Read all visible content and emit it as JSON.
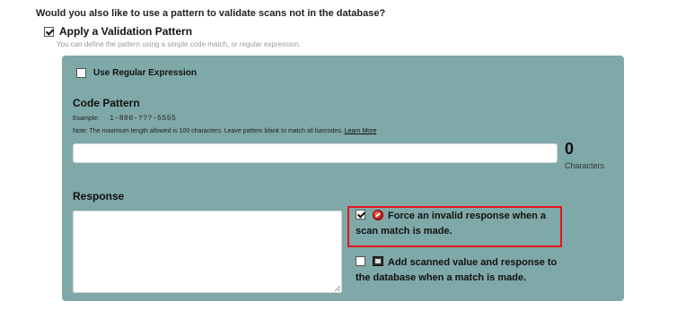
{
  "header": {
    "question": "Would you also like to use a pattern to validate scans not in the database?"
  },
  "validation": {
    "checked": true,
    "label": "Apply a Validation Pattern",
    "description": "You can define the pattern using a simple code match, or regular expression."
  },
  "panel": {
    "bg_color": "#7fa8a8",
    "regex": {
      "checked": false,
      "label": "Use Regular Expression"
    },
    "code_pattern": {
      "title": "Code Pattern",
      "example_label": "Example:",
      "example_value": "1-800-???-5555",
      "note": "Note: The maximum length allowed is 100 characters. Leave pattern blank to match all barcodes.",
      "learn_more": "Learn More",
      "input_value": "",
      "char_count": "0",
      "char_label": "Characters"
    },
    "response": {
      "title": "Response",
      "value": ""
    },
    "options": {
      "force_invalid": {
        "checked": true,
        "icon": "stop-icon",
        "label": "Force an invalid response when a scan match is made.",
        "highlight_color": "#e2161e"
      },
      "add_to_db": {
        "checked": false,
        "icon": "database-add-icon",
        "label": "Add scanned value and response to the database when a match is made."
      }
    }
  }
}
